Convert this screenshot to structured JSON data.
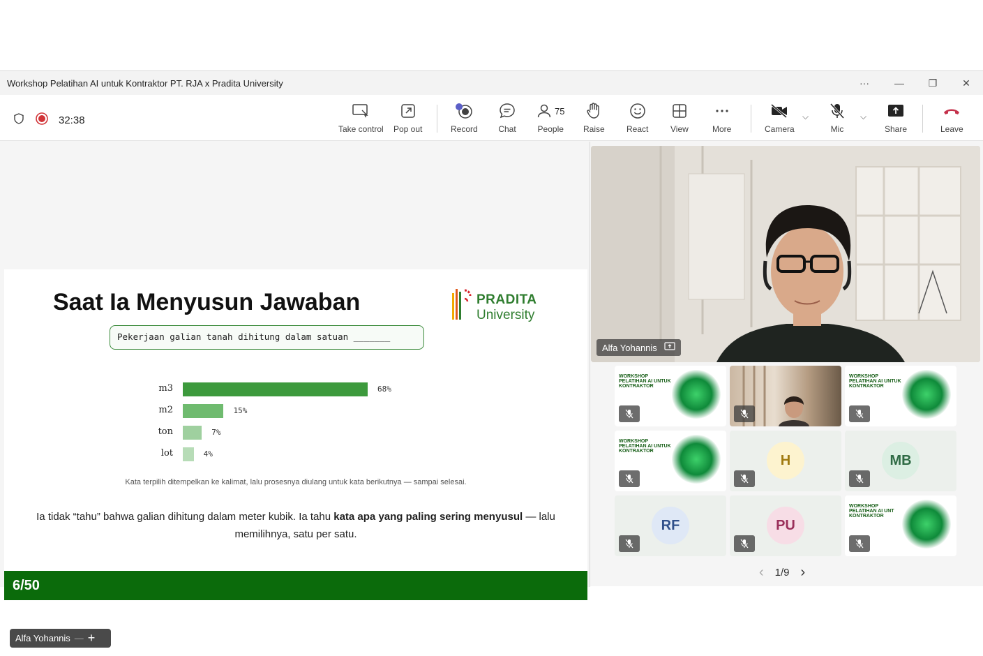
{
  "window": {
    "title": "Workshop Pelatihan AI untuk Kontraktor PT. RJA x Pradita University",
    "more_label": "···",
    "minimize_label": "—",
    "restore_label": "❐",
    "close_label": "✕"
  },
  "toolbar": {
    "timer": "32:38",
    "take_control": "Take control",
    "pop_out": "Pop out",
    "record": "Record",
    "chat": "Chat",
    "people": "People",
    "people_count": "75",
    "raise": "Raise",
    "react": "React",
    "view": "View",
    "more": "More",
    "camera": "Camera",
    "mic": "Mic",
    "share": "Share",
    "leave": "Leave",
    "record_color": "#d13438",
    "leave_color": "#c4314b"
  },
  "slide": {
    "title": "Saat Ia Menyusun Jawaban",
    "question": "Pekerjaan galian tanah dihitung dalam satuan _______",
    "logo_line1": "PRADITA",
    "logo_line2": "University",
    "caption": "Kata terpilih ditempelkan ke kalimat, lalu prosesnya diulang untuk kata berikutnya — sampai selesai.",
    "body_plain1": "Ia tidak “tahu” bahwa galian dihitung dalam meter kubik. Ia tahu ",
    "body_bold": "kata apa yang paling sering menyusul",
    "body_plain2": " — lalu memilihnya, satu per satu.",
    "page": "6/50",
    "brand_color": "#0b6b0b"
  },
  "chart_data": {
    "type": "bar",
    "orientation": "horizontal",
    "categories": [
      "m3",
      "m2",
      "ton",
      "lot"
    ],
    "values": [
      68,
      15,
      7,
      4
    ],
    "value_labels": [
      "68%",
      "15%",
      "7%",
      "4%"
    ],
    "colors": [
      "#3d9a3d",
      "#6fbb6f",
      "#9fd09f",
      "#b7dcb7"
    ],
    "xlim": [
      0,
      68
    ]
  },
  "presenter": {
    "name": "Alfa Yohannis",
    "minus": "—",
    "plus": "+"
  },
  "main_video": {
    "name": "Alfa Yohannis"
  },
  "tiles": [
    {
      "kind": "webinar",
      "text": "WORKSHOP PELATIHAN AI UNTUK KONTRAKTOR"
    },
    {
      "kind": "camera",
      "text": ""
    },
    {
      "kind": "webinar",
      "text": "WORKSHOP PELATIHAN AI UNTUK KONTRAKTOR"
    },
    {
      "kind": "webinar",
      "text": "WORKSHOP PELATIHAN AI UNTUK KONTRAKTOR"
    },
    {
      "kind": "avatar",
      "text": "H",
      "bg": "#fdf3cf",
      "fg": "#a07a10"
    },
    {
      "kind": "avatar",
      "text": "MB",
      "bg": "#dcefe3",
      "fg": "#2f6b45"
    },
    {
      "kind": "avatar",
      "text": "RF",
      "bg": "#dfe8f6",
      "fg": "#2f4f8a"
    },
    {
      "kind": "avatar",
      "text": "PU",
      "bg": "#f7dde6",
      "fg": "#9a2f5a"
    },
    {
      "kind": "webinar",
      "text": "WORKSHOP PELATIHAN AI UNT KONTRAKTOR"
    }
  ],
  "pager": {
    "prev": "‹",
    "label": "1/9",
    "next": "›"
  }
}
